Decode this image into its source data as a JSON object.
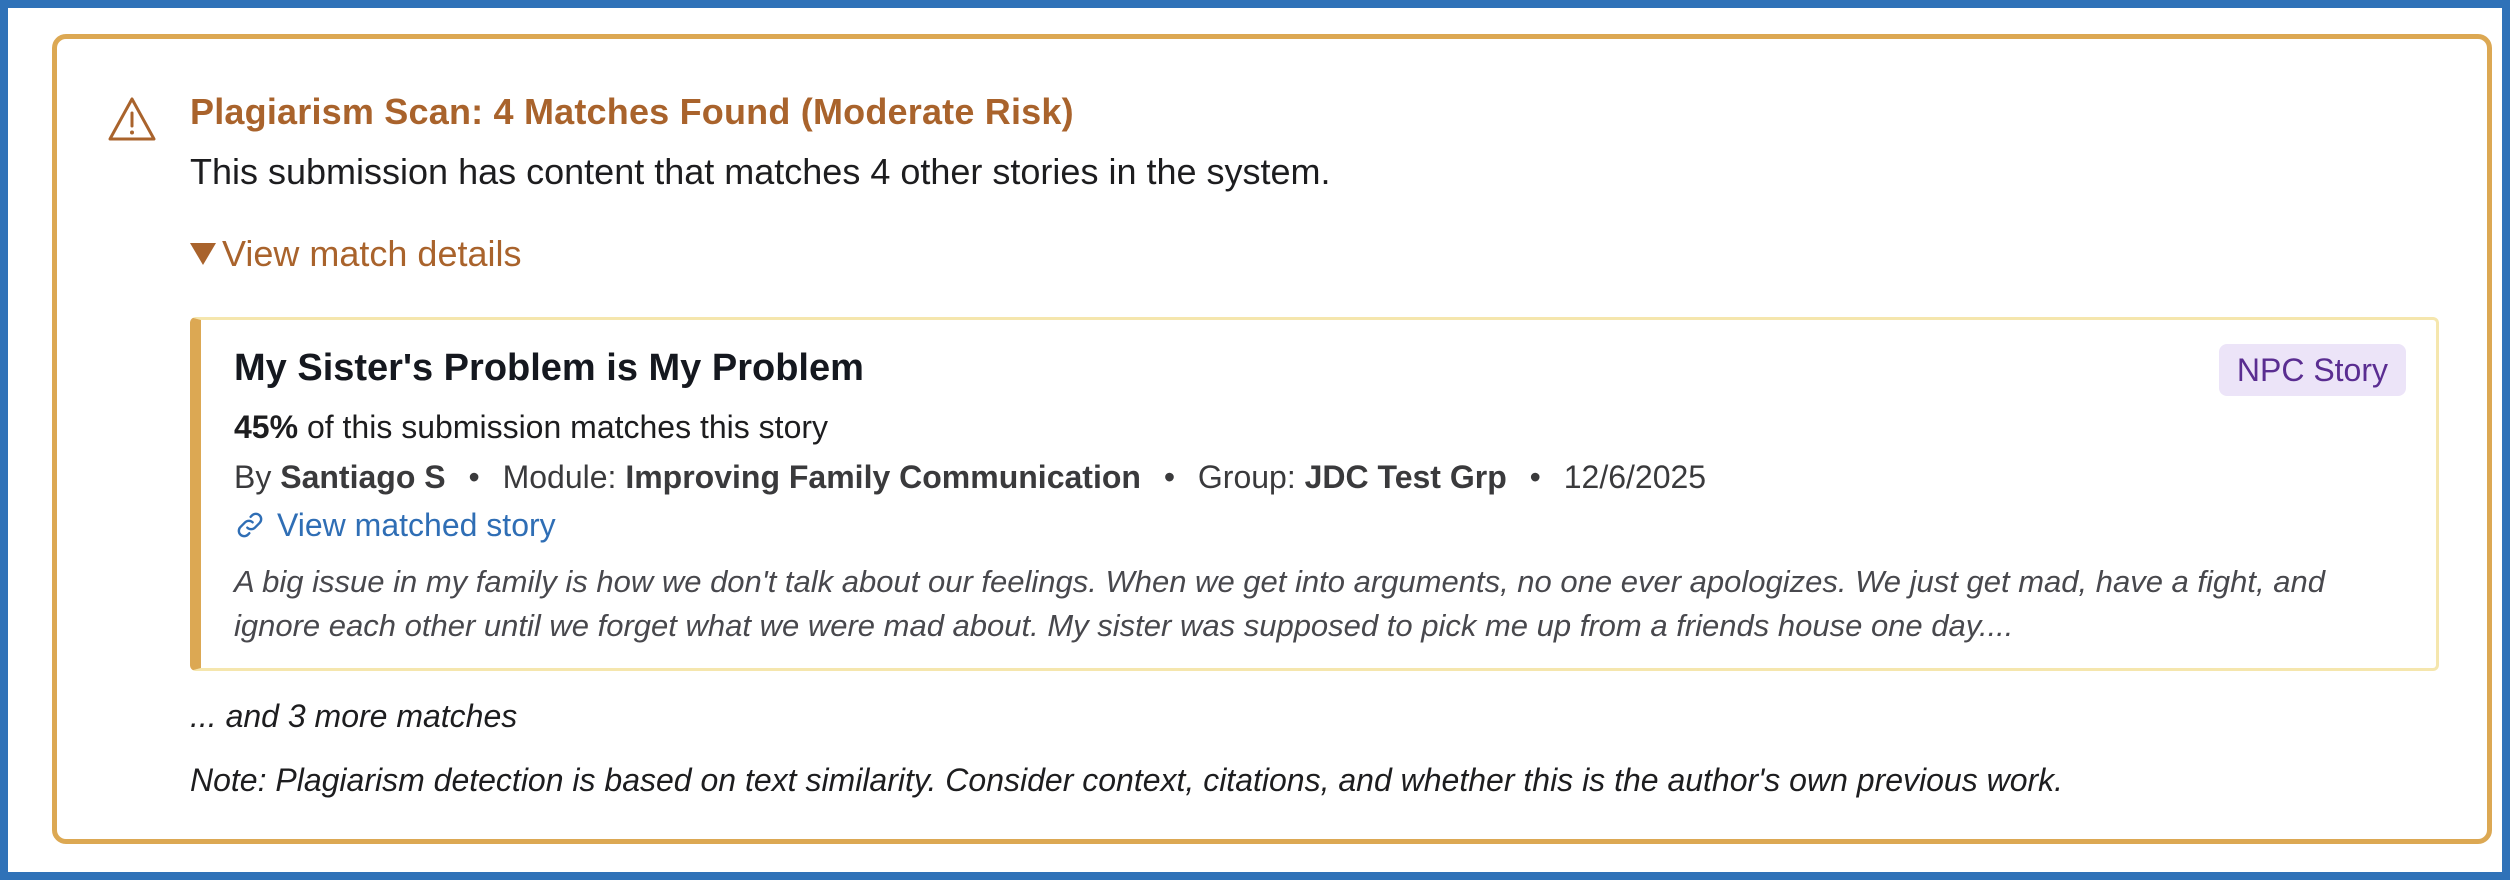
{
  "alert": {
    "title": "Plagiarism Scan: 4 Matches Found (Moderate Risk)",
    "subtitle": "This submission has content that matches 4 other stories in the system.",
    "icon": "warning-triangle-icon",
    "accent_color": "#dca853",
    "title_color": "#a9632c"
  },
  "details": {
    "toggle_label": "View match details",
    "expanded": true
  },
  "match": {
    "title": "My Sister's Problem is My Problem",
    "badge": "NPC Story",
    "percent": "45%",
    "percent_suffix": "of this submission matches this story",
    "by_label": "By",
    "author": "Santiago S",
    "module_label": "Module:",
    "module": "Improving Family Communication",
    "group_label": "Group:",
    "group": "JDC Test Grp",
    "date": "12/6/2025",
    "separator": "•",
    "link_label": "View matched story",
    "excerpt": "A big issue in my family is how we don't talk about our feelings. When we get into arguments, no one ever apologizes. We just get mad, have a fight, and ignore each other until we forget what we were mad about. My sister was supposed to pick me up from a friends house one day...."
  },
  "more_matches": "... and 3 more matches",
  "note": "Note: Plagiarism detection is based on text similarity. Consider context, citations, and whether this is the author's own previous work."
}
